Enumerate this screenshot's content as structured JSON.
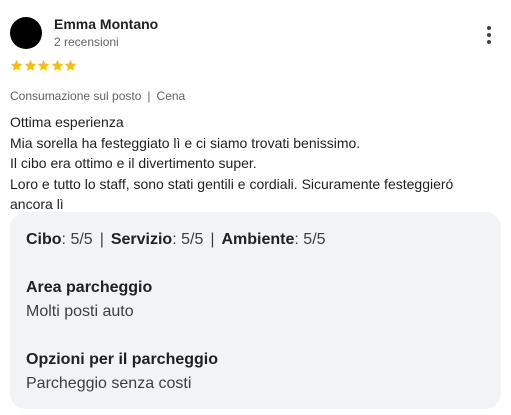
{
  "reviewer": {
    "name": "Emma Montano",
    "reviews_count": "2 recensioni"
  },
  "rating": {
    "stars": 5,
    "max": 5,
    "star_color": "#fbbc04"
  },
  "meta": {
    "type": "Consumazione sul posto",
    "separator": "|",
    "meal": "Cena"
  },
  "review": {
    "lines": [
      "Ottima esperienza",
      "Mia sorella ha festeggiato lì e ci siamo trovati benissimo.",
      "Il cibo era ottimo e il divertimento super.",
      "Loro e tutto lo staff, sono stati gentili e cordiali. Sicuramente festeggieró",
      "ancora lì"
    ]
  },
  "details": {
    "ratings": [
      {
        "label": "Cibo",
        "value": "5/5"
      },
      {
        "label": "Servizio",
        "value": "5/5"
      },
      {
        "label": "Ambiente",
        "value": "5/5"
      }
    ],
    "ratings_separator": "|",
    "sections": [
      {
        "title": "Area parcheggio",
        "value": "Molti posti auto"
      },
      {
        "title": "Opzioni per il parcheggio",
        "value": "Parcheggio senza costi"
      }
    ]
  },
  "icons": {
    "menu": "more-vert-icon",
    "star": "star-icon"
  }
}
